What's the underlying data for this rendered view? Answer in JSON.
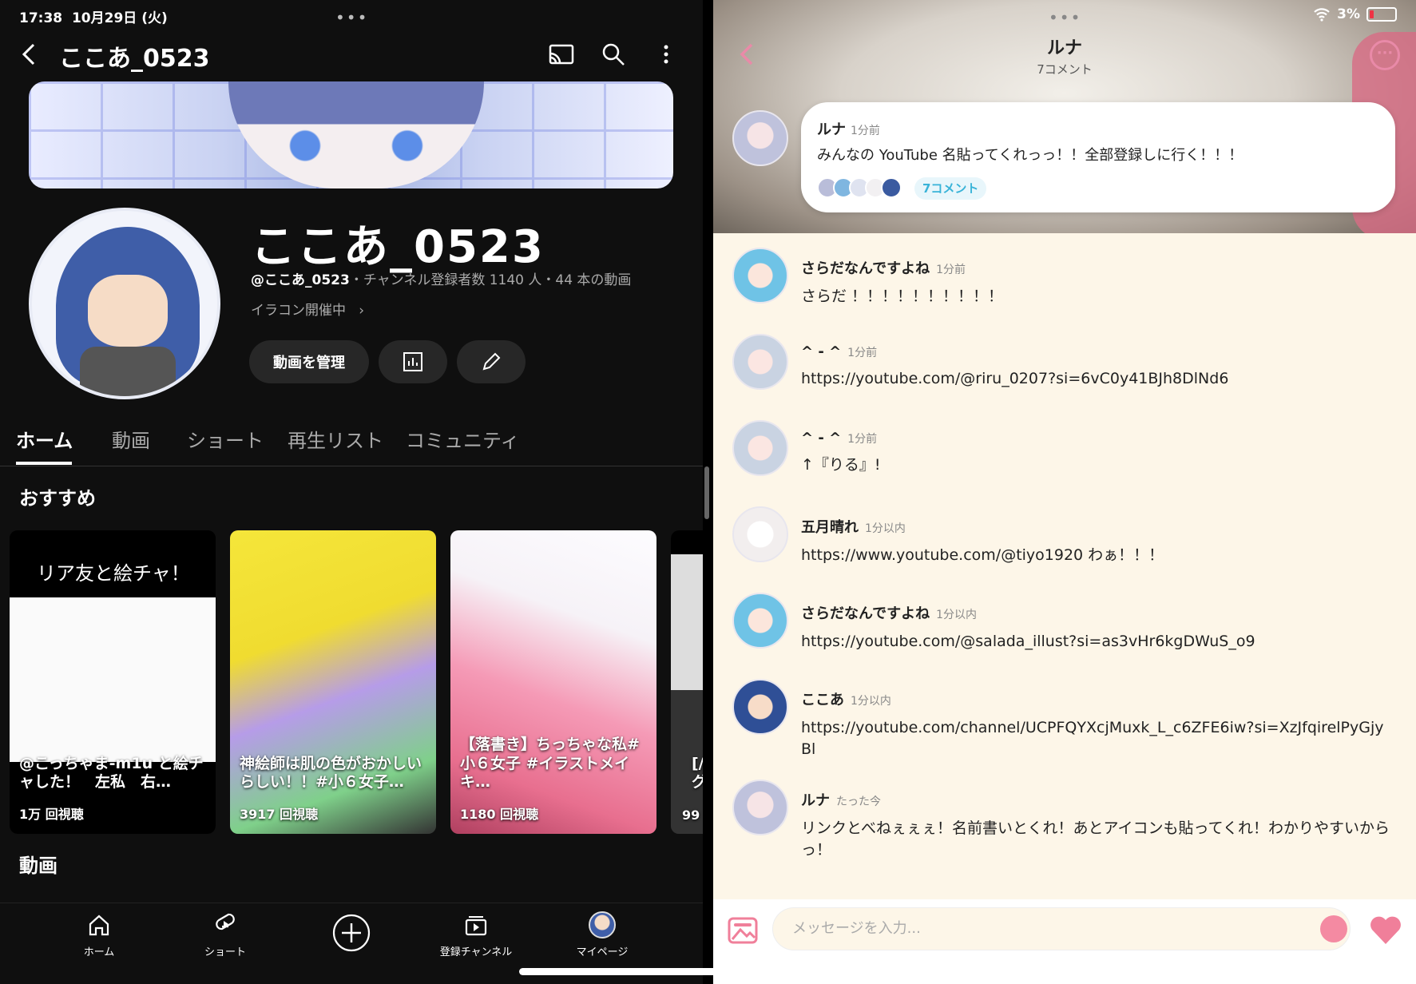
{
  "status": {
    "time": "17:38",
    "date": "10月29日 (火)",
    "battery": "3%"
  },
  "youtube": {
    "title": "ここあ_0523",
    "channel_name": "ここあ_0523",
    "handle": "@ここあ_0523",
    "meta_rest": "・チャンネル登録者数 1140 人・44 本の動画",
    "link_text": "イラコン開催中",
    "manage_button": "動画を管理",
    "tabs": [
      "ホーム",
      "動画",
      "ショート",
      "再生リスト",
      "コミュニティ"
    ],
    "section_recommended": "おすすめ",
    "section_videos": "動画",
    "cards": [
      {
        "top_text": "リア友と絵チャ！",
        "caption": "@こっちゃま-m1u と絵チャした！　左私　右…",
        "views": "1万 回視聴"
      },
      {
        "caption": "神絵師は肌の色がおかしいらしい！！#小６女子…",
        "views": "3917 回視聴"
      },
      {
        "caption": "【落書き】ちっちゃな私#小６女子 #イラストメイキ…",
        "views": "1180 回視聴"
      },
      {
        "caption": "[/グ]",
        "views": "99"
      }
    ],
    "nav": [
      "ホーム",
      "ショート",
      "",
      "登録チャンネル",
      "マイページ"
    ]
  },
  "chat": {
    "title": "ルナ",
    "subtitle": "7コメント",
    "main_post": {
      "name": "ルナ",
      "time": "1分前",
      "text": "みんなの YouTube 名貼ってくれっっ！！全部登録しに行く！！！",
      "count": "7コメント"
    },
    "comments": [
      {
        "name": "さらだなんですよね",
        "time": "1分前",
        "text": "さらだ  ！！！！！！！！！！"
      },
      {
        "name": "^ - ^",
        "time": "1分前",
        "text": "https://youtube.com/@riru_0207?si=6vC0y41BJh8DlNd6"
      },
      {
        "name": "^ - ^",
        "time": "1分前",
        "text": "↑『りる』!"
      },
      {
        "name": "五月晴れ",
        "time": "1分以内",
        "text": "https://www.youtube.com/@tiyo1920        わぁ！！！"
      },
      {
        "name": "さらだなんですよね",
        "time": "1分以内",
        "text": "https://youtube.com/@salada_illust?si=as3vHr6kgDWuS_o9"
      },
      {
        "name": "ここあ",
        "time": "1分以内",
        "text": "https://youtube.com/channel/UCPFQYXcjMuxk_L_c6ZFE6iw?si=XzJfqirelPyGjyBl"
      },
      {
        "name": "ルナ",
        "time": "たった今",
        "text": "リンクとべねぇぇぇ！名前書いとくれ！あとアイコンも貼ってくれ！わかりやすいからっ！"
      }
    ],
    "input_placeholder": "メッセージを入力..."
  },
  "colors": {
    "yt_bg": "#0f0f0f",
    "chat_bg": "#fdf6e8",
    "accent_pink": "#f48aa2",
    "accent_blue": "#38b3d8"
  }
}
